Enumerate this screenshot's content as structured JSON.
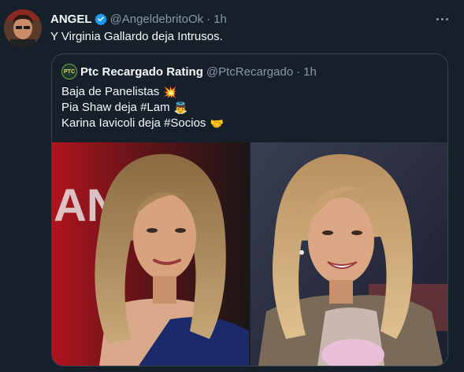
{
  "tweet": {
    "author_name": "ANGEL",
    "handle": "@AngeldebritoOk",
    "separator": "·",
    "time": "1h",
    "text": "Y Virginia Gallardo deja Intrusos.",
    "avatar_icon": "profile-photo"
  },
  "quoted": {
    "author_name": "Ptc Recargado Rating",
    "handle": "@PtcRecargado",
    "separator": "·",
    "time": "1h",
    "avatar_text": "PTC",
    "lines": [
      {
        "text": "Baja de Panelistas",
        "emoji": "💥",
        "emoji_name": "collision-emoji"
      },
      {
        "text": "Pia Shaw deja #Lam",
        "emoji": "👼",
        "emoji_name": "angel-emoji"
      },
      {
        "text": "Karina Iavicoli deja #Socios",
        "emoji": "🤝",
        "emoji_name": "handshake-emoji"
      }
    ],
    "photos": [
      "photo-woman-sequin-dress",
      "photo-woman-smiling-studio"
    ],
    "photo_text": "AN"
  },
  "colors": {
    "background": "#15202b",
    "text": "#f7f9f9",
    "secondary": "#8b98a5",
    "border": "#38444d",
    "verified": "#1d9bf0"
  }
}
